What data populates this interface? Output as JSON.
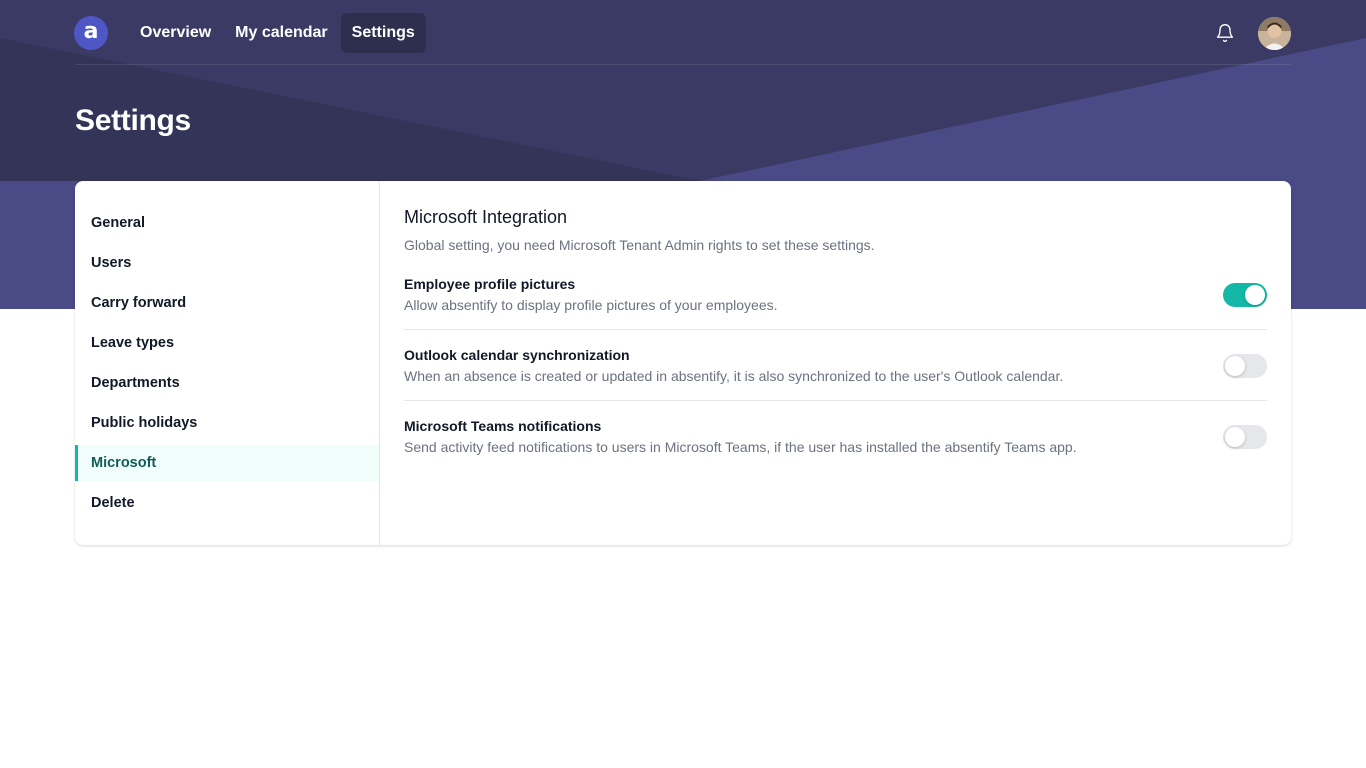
{
  "nav": {
    "logo_letter": "a",
    "links": [
      {
        "label": "Overview",
        "active": false
      },
      {
        "label": "My calendar",
        "active": false
      },
      {
        "label": "Settings",
        "active": true
      }
    ],
    "icons": {
      "notifications": "bell-icon",
      "profile": "avatar"
    }
  },
  "page": {
    "title": "Settings"
  },
  "sidebar": {
    "items": [
      {
        "label": "General",
        "active": false
      },
      {
        "label": "Users",
        "active": false
      },
      {
        "label": "Carry forward",
        "active": false
      },
      {
        "label": "Leave types",
        "active": false
      },
      {
        "label": "Departments",
        "active": false
      },
      {
        "label": "Public holidays",
        "active": false
      },
      {
        "label": "Microsoft",
        "active": true
      },
      {
        "label": "Delete",
        "active": false
      }
    ]
  },
  "section": {
    "title": "Microsoft Integration",
    "subtitle": "Global setting, you need Microsoft Tenant Admin rights to set these settings.",
    "settings": [
      {
        "title": "Employee profile pictures",
        "description": "Allow absentify to display profile pictures of your employees.",
        "enabled": true
      },
      {
        "title": "Outlook calendar synchronization",
        "description": "When an absence is created or updated in absentify, it is also synchronized to the user's Outlook calendar.",
        "enabled": false
      },
      {
        "title": "Microsoft Teams notifications",
        "description": "Send activity feed notifications to users in Microsoft Teams, if the user has installed the absentify Teams app.",
        "enabled": false
      }
    ]
  },
  "colors": {
    "banner": "#3a3a64",
    "banner_accent": "#4a4a86",
    "accent": "#14b8a6",
    "logo": "#4f56c6"
  }
}
